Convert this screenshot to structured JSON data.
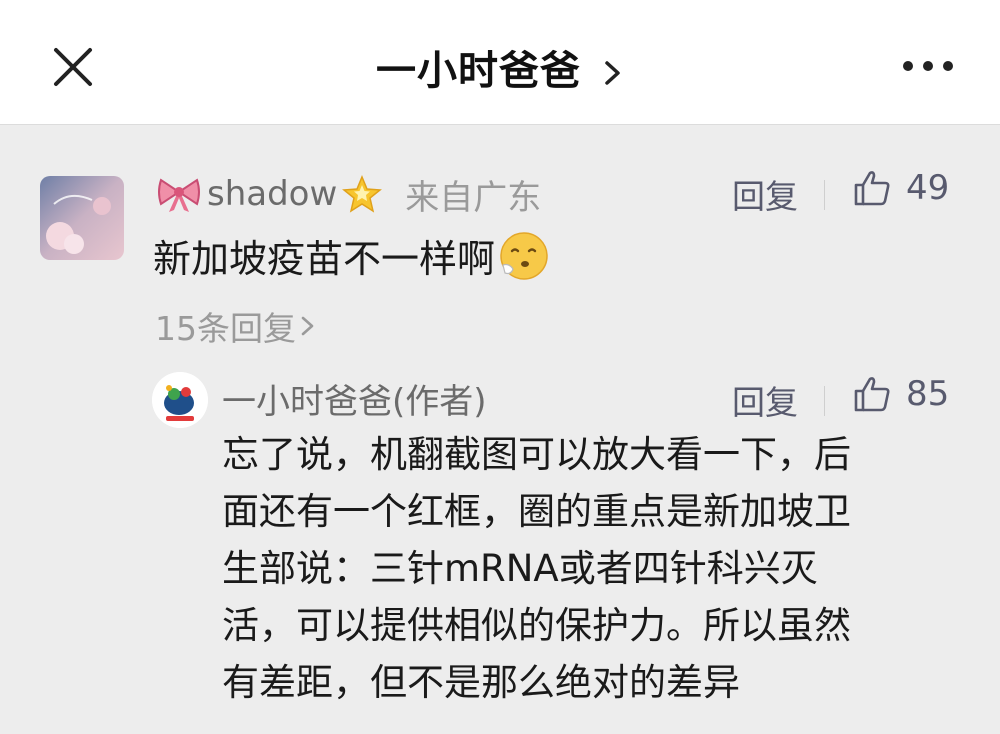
{
  "header": {
    "title": "一小时爸爸"
  },
  "comment": {
    "username": "shadow",
    "location": "来自广东",
    "reply_label": "回复",
    "like_count": "49",
    "text": "新加坡疫苗不一样啊",
    "replies_link": "15条回复"
  },
  "author_reply": {
    "name": "一小时爸爸(作者)",
    "reply_label": "回复",
    "like_count": "85",
    "lines": [
      "忘了说，机翻截图可以放大看一下，后",
      "面还有一个红框，圈的重点是新加坡卫",
      "生部说：三针mRNA或者四针科兴灭",
      "活，可以提供相似的保护力。所以虽然",
      "有差距，但不是那么绝对的差异"
    ]
  },
  "colors": {
    "background": "#ededed",
    "topbar": "#ffffff",
    "action_text": "#585a6e",
    "name_text": "#6b6b6b",
    "muted_text": "#9a9a9a"
  },
  "icons": [
    "close-icon",
    "chevron-right-icon",
    "more-icon",
    "bow-icon",
    "star-icon",
    "thumbs-up-icon",
    "sad-emoji-icon"
  ]
}
